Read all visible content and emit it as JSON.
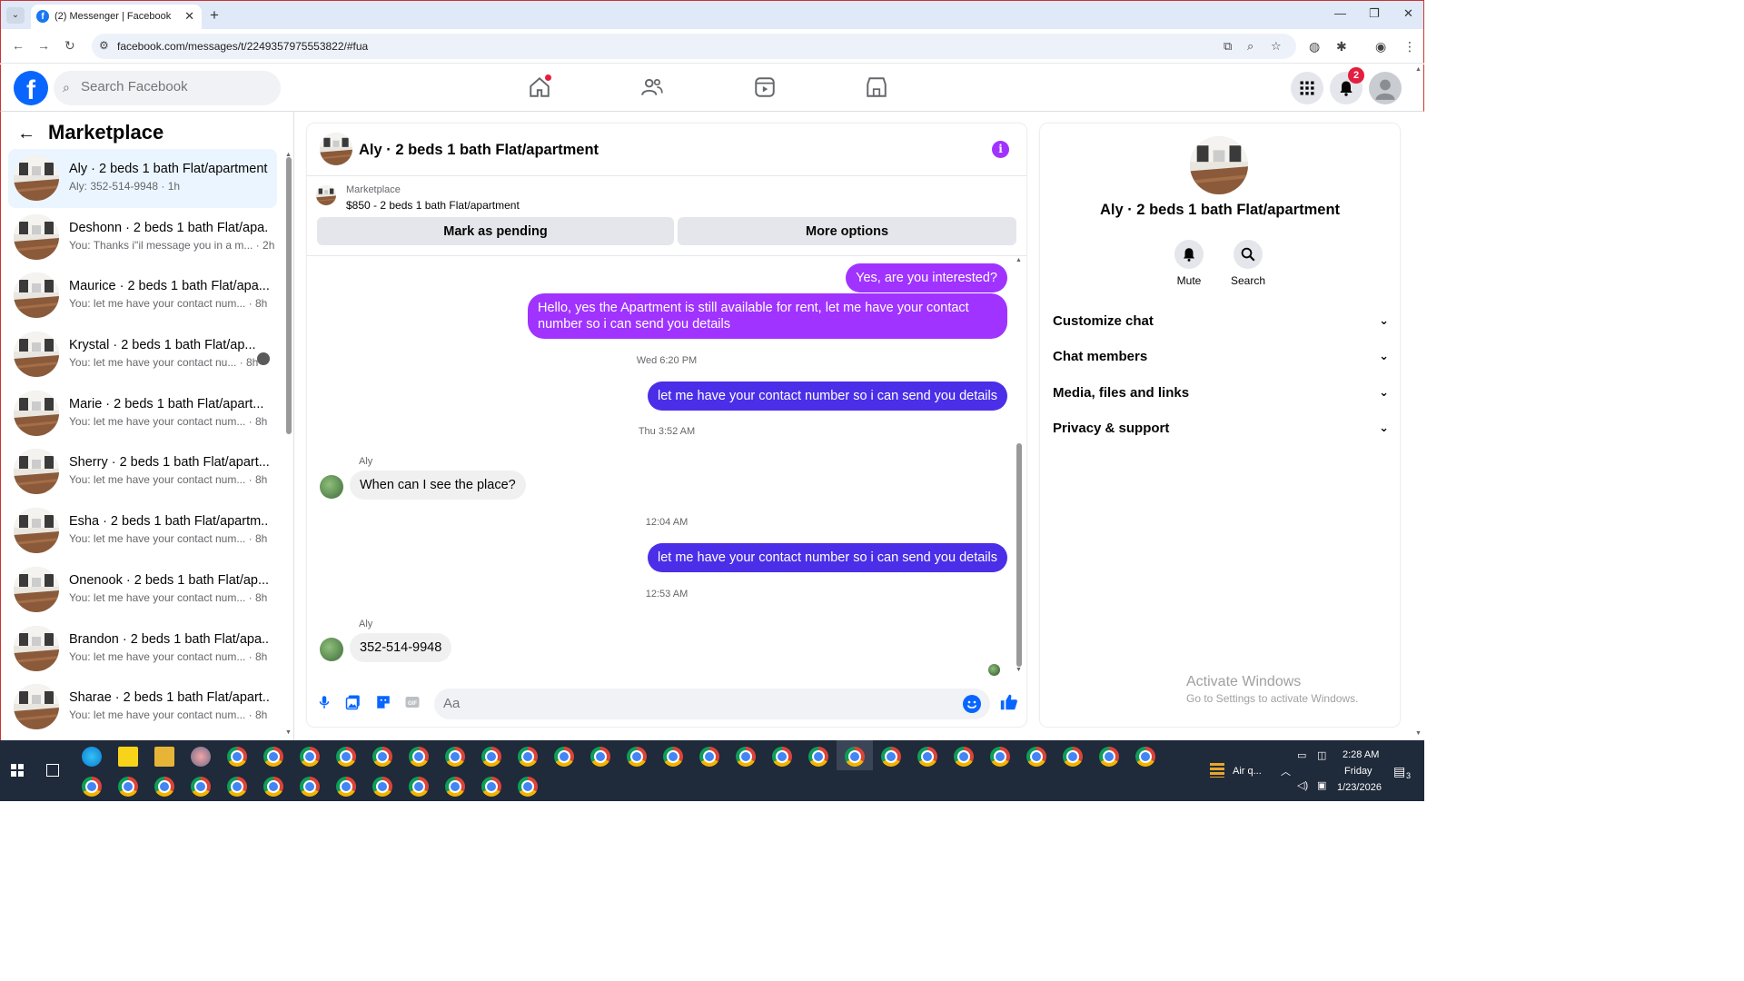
{
  "browser": {
    "tab_title": "(2) Messenger | Facebook",
    "url": "facebook.com/messages/t/2249357975553822/#fua"
  },
  "fb": {
    "search_placeholder": "Search Facebook",
    "notification_count": "2"
  },
  "left": {
    "title": "Marketplace",
    "conversations": [
      {
        "name": "Aly · 2 beds 1 bath Flat/apartment",
        "sub": "Aly: 352-514-9948 · 1h",
        "active": true
      },
      {
        "name": "Deshonn · 2 beds 1 bath Flat/apa...",
        "sub": "You: Thanks i\"il message you in a m... · 2h"
      },
      {
        "name": "Maurice · 2 beds 1 bath Flat/apa...",
        "sub": "You: let me have your contact num... · 8h"
      },
      {
        "name": "Krystal · 2 beds 1 bath Flat/ap...",
        "sub": "You: let me have your contact nu... · 8h",
        "seen": true
      },
      {
        "name": "Marie · 2 beds 1 bath Flat/apart...",
        "sub": "You: let me have your contact num... · 8h"
      },
      {
        "name": "Sherry · 2 beds 1 bath Flat/apart...",
        "sub": "You: let me have your contact num... · 8h"
      },
      {
        "name": "Esha · 2 beds 1 bath Flat/apartm...",
        "sub": "You: let me have your contact num... · 8h"
      },
      {
        "name": "Onenook · 2 beds 1 bath Flat/ap...",
        "sub": "You: let me have your contact num... · 8h"
      },
      {
        "name": "Brandon · 2 beds 1 bath Flat/apa...",
        "sub": "You: let me have your contact num... · 8h"
      },
      {
        "name": "Sharae · 2 beds 1 bath Flat/apart...",
        "sub": "You: let me have your contact num... · 8h"
      }
    ]
  },
  "chat": {
    "title": "Aly · 2 beds 1 bath Flat/apartment",
    "listing_source": "Marketplace",
    "listing_price": "$850 - 2 beds 1 bath Flat/apartment",
    "btn_pending": "Mark as pending",
    "btn_more": "More options",
    "messages": {
      "m1": "Yes, are you interested?",
      "m2": "Hello, yes the Apartment is still available for rent, let me have your contact number so i can send you details",
      "t1": "Wed 6:20 PM",
      "m3": "let me have your contact number so i can send you details",
      "t2": "Thu 3:52 AM",
      "s1": "Aly",
      "m4": "When can I see the place?",
      "t3": "12:04 AM",
      "m5": "let me have your contact number so i can send you details",
      "t4": "12:53 AM",
      "s2": "Aly",
      "m6": "352-514-9948"
    },
    "composer_placeholder": "Aa"
  },
  "right": {
    "name": "Aly · 2 beds 1 bath Flat/apartment",
    "mute": "Mute",
    "search": "Search",
    "sections": [
      "Customize chat",
      "Chat members",
      "Media, files and links",
      "Privacy & support"
    ]
  },
  "watermark": {
    "line1": "Activate Windows",
    "line2": "Go to Settings to activate Windows."
  },
  "taskbar": {
    "weather": "Air q...",
    "time": "2:28 AM",
    "day": "Friday",
    "date": "1/23/2026",
    "notif": "3"
  },
  "colors": {
    "fb_blue": "#0866ff",
    "bubble_purple": "#a033ff",
    "bubble_blue": "#4a2ee8",
    "active_conv": "#ebf5ff"
  }
}
